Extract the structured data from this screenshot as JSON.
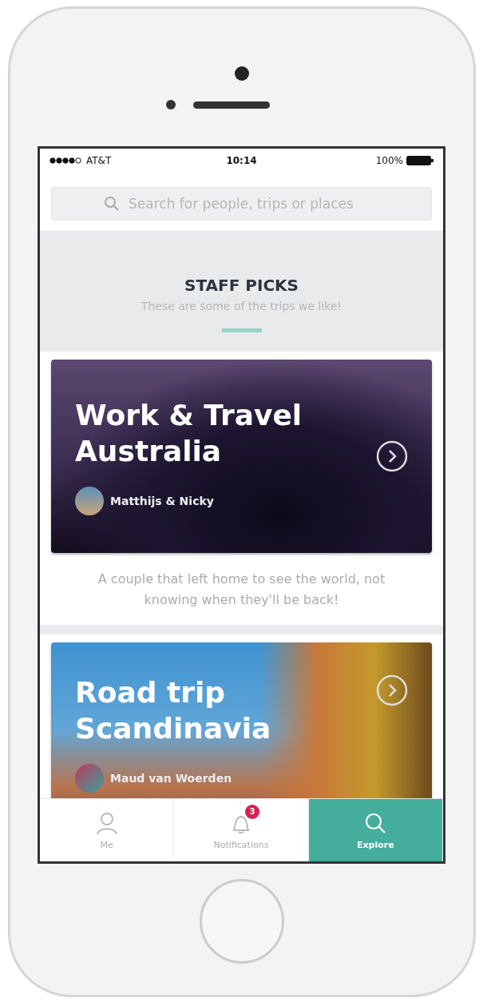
{
  "status_bar": {
    "carrier": "AT&T",
    "time": "10:14",
    "battery": "100%"
  },
  "search": {
    "placeholder": "Search for people, trips or places"
  },
  "section": {
    "title": "STAFF PICKS",
    "subtitle": "These are some of the trips we like!"
  },
  "trips": [
    {
      "title": "Work & Travel Australia",
      "author": "Matthijs & Nicky",
      "description": "A couple that left home to see the world, not knowing when they'll be back!"
    },
    {
      "title": "Road trip Scandinavia",
      "author": "Maud van Woerden"
    }
  ],
  "tabs": [
    {
      "label": "Me",
      "selected": false
    },
    {
      "label": "Notifications",
      "badge": "3",
      "selected": false
    },
    {
      "label": "Explore",
      "selected": true
    }
  ]
}
